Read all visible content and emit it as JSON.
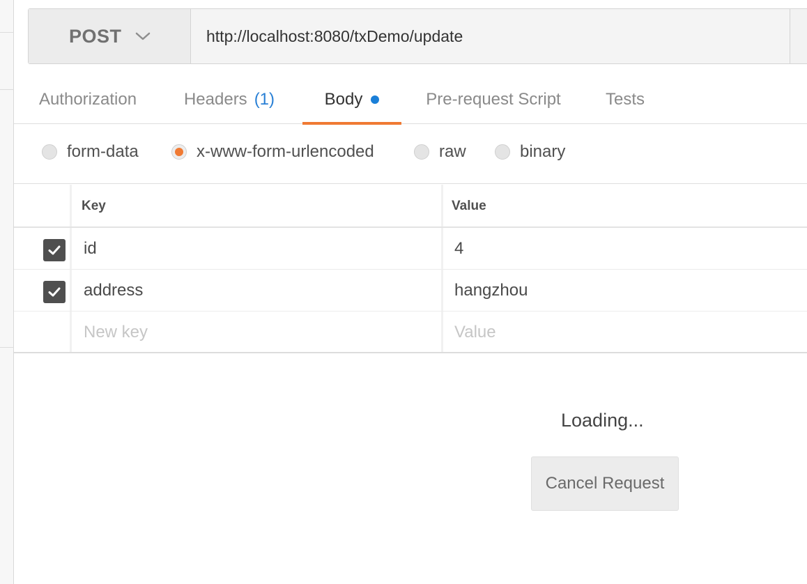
{
  "request": {
    "method": "POST",
    "url": "http://localhost:8080/txDemo/update"
  },
  "tabs": [
    {
      "label": "Authorization"
    },
    {
      "label": "Headers",
      "count": "(1)"
    },
    {
      "label": "Body",
      "active": true
    },
    {
      "label": "Pre-request Script"
    },
    {
      "label": "Tests"
    }
  ],
  "body_types": [
    {
      "label": "form-data",
      "selected": false
    },
    {
      "label": "x-www-form-urlencoded",
      "selected": true
    },
    {
      "label": "raw",
      "selected": false
    },
    {
      "label": "binary",
      "selected": false
    }
  ],
  "kv_table": {
    "headers": {
      "key": "Key",
      "value": "Value"
    },
    "rows": [
      {
        "key": "id",
        "value": "4",
        "checked": true
      },
      {
        "key": "address",
        "value": "hangzhou",
        "checked": true
      }
    ],
    "new_row": {
      "key_placeholder": "New key",
      "value_placeholder": "Value"
    }
  },
  "status": {
    "loading_text": "Loading...",
    "cancel_label": "Cancel Request"
  },
  "colors": {
    "accent": "#f07a33",
    "count_blue": "#2a80d5",
    "dot_blue": "#1a7fd8"
  },
  "icons": {
    "method_dropdown": "chevron-down-icon",
    "checkbox_mark": "checkmark-icon",
    "body_dot": "dot-icon"
  }
}
